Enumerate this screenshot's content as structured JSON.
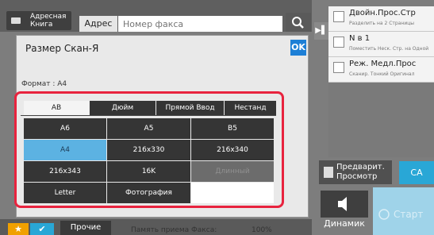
{
  "header": {
    "address_book_label": "Адресная Книга",
    "address_tab": "Адрес",
    "fax_placeholder": "Номер факса"
  },
  "options": [
    {
      "title": "Двойн.Прос.Стр",
      "subtitle": "Разделить на 2 Страницы"
    },
    {
      "title": "N в 1",
      "subtitle": "Поместить Неск. Стр. на Одной"
    },
    {
      "title": "Реж. Медл.Прос",
      "subtitle": "Сканир. Тонкий Оригинал"
    }
  ],
  "dialog": {
    "title": "Размер Скан-Я",
    "ok_label": "OK",
    "format_label": "Формат : A4",
    "tabs": [
      {
        "label": "AB",
        "active": true
      },
      {
        "label": "Дюйм",
        "active": false
      },
      {
        "label": "Прямой Ввод",
        "active": false
      },
      {
        "label": "Нестанд формат",
        "active": false
      }
    ],
    "sizes": [
      [
        "A6",
        "A5",
        "B5"
      ],
      [
        "A4",
        "216x330",
        "216x340"
      ],
      [
        "216x343",
        "16K",
        "Длинный"
      ],
      [
        "Letter",
        "Фотография",
        ""
      ]
    ],
    "selected_size": "A4",
    "disabled_size": "Длинный"
  },
  "actions": {
    "preview_label": "Предварит. Просмотр",
    "ca_label": "CA",
    "speaker_label": "Динамик",
    "start_label": "Старт"
  },
  "footer": {
    "other_label": "Прочие",
    "memory_label": "Память приема Факса:",
    "memory_value": "100%"
  },
  "colors": {
    "accent": "#29a7d6",
    "selected": "#5cb2e2",
    "highlight_frame": "#e8233e",
    "favorite": "#f0a000"
  }
}
